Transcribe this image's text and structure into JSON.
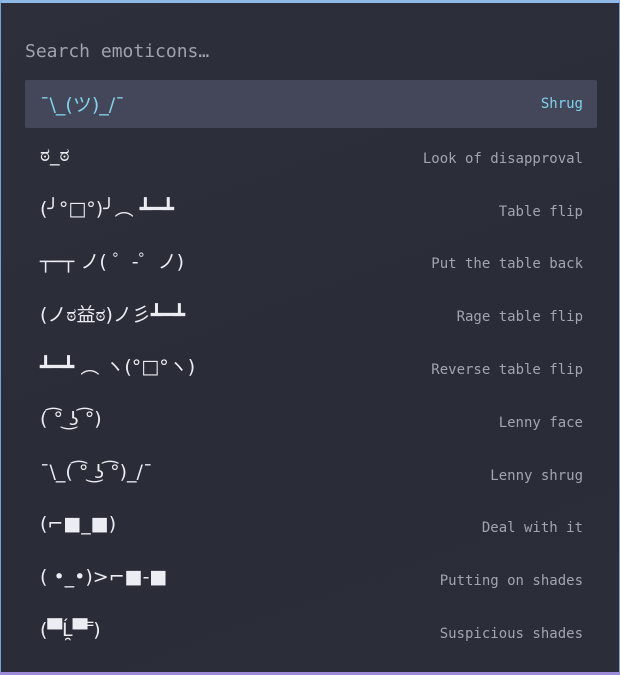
{
  "search": {
    "placeholder": "Search emoticons…",
    "value": ""
  },
  "items": [
    {
      "emoticon": "¯\\_(ツ)_/¯",
      "label": "Shrug",
      "selected": true
    },
    {
      "emoticon": "ಠ_ಠ",
      "label": "Look of disapproval",
      "selected": false
    },
    {
      "emoticon": "(╯°□°)╯︵ ┻━┻",
      "label": "Table flip",
      "selected": false
    },
    {
      "emoticon": "┬─┬ ノ( ゜-゜ノ)",
      "label": "Put the table back",
      "selected": false
    },
    {
      "emoticon": "(ノಠ益ಠ)ノ彡┻━┻",
      "label": "Rage table flip",
      "selected": false
    },
    {
      "emoticon": "┻━┻ ︵ ヽ(°□°ヽ)",
      "label": "Reverse table flip",
      "selected": false
    },
    {
      "emoticon": "( ͡° ͜ʖ ͡°)",
      "label": "Lenny face",
      "selected": false
    },
    {
      "emoticon": "¯\\_( ͡° ͜ʖ ͡°)_/¯",
      "label": "Lenny shrug",
      "selected": false
    },
    {
      "emoticon": "(⌐■_■)",
      "label": "Deal with it",
      "selected": false
    },
    {
      "emoticon": "( •_•)>⌐■-■",
      "label": "Putting on shades",
      "selected": false
    },
    {
      "emoticon": "(▀̿Ĺ̯▀̿ ̿)",
      "label": "Suspicious shades",
      "selected": false
    }
  ],
  "colors": {
    "accent": "#7fd3ec",
    "selected_bg": "#444759",
    "window_bg": "#2a2c37",
    "border_top": "#8fb9e6",
    "border_bottom": "#9d8ad8"
  }
}
